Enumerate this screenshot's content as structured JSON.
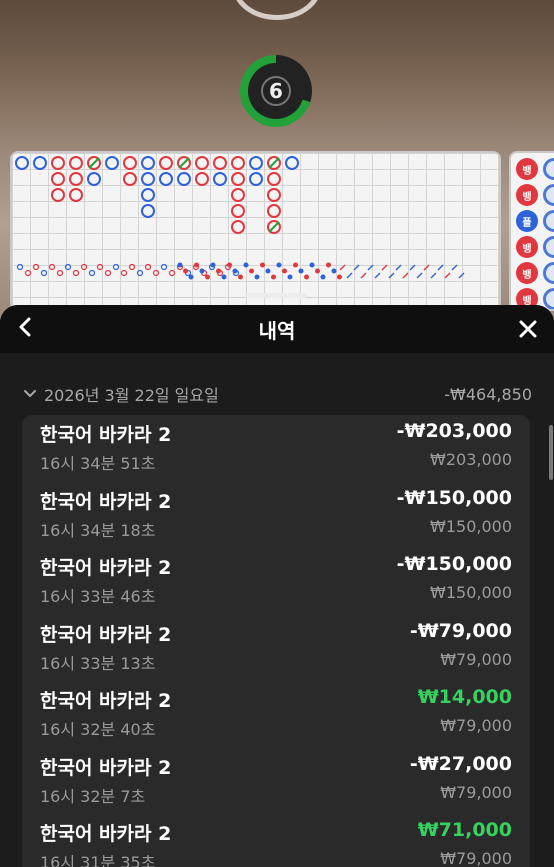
{
  "game": {
    "countdown": "6",
    "side_chips": [
      {
        "label": "뱅",
        "color": "#e0383e"
      },
      {
        "label": "뱅",
        "color": "#e0383e"
      },
      {
        "label": "플",
        "color": "#2d62d9"
      },
      {
        "label": "뱅",
        "color": "#e0383e"
      },
      {
        "label": "뱅",
        "color": "#e0383e"
      },
      {
        "label": "뱅",
        "color": "#e0383e"
      }
    ]
  },
  "sheet": {
    "title": "내역",
    "back_icon": "chevron-left-icon",
    "close_icon": "close-icon"
  },
  "date_group": {
    "date": "2026년 3월 22일 일요일",
    "total": "-₩464,850"
  },
  "transactions": [
    {
      "game": "한국어 바카라 2",
      "time": "16시 34분 51초",
      "result": "-₩203,000",
      "stake": "₩203,000",
      "positive": false
    },
    {
      "game": "한국어 바카라 2",
      "time": "16시 34분 18초",
      "result": "-₩150,000",
      "stake": "₩150,000",
      "positive": false
    },
    {
      "game": "한국어 바카라 2",
      "time": "16시 33분 46초",
      "result": "-₩150,000",
      "stake": "₩150,000",
      "positive": false
    },
    {
      "game": "한국어 바카라 2",
      "time": "16시 33분 13초",
      "result": "-₩79,000",
      "stake": "₩79,000",
      "positive": false
    },
    {
      "game": "한국어 바카라 2",
      "time": "16시 32분 40초",
      "result": "₩14,000",
      "stake": "₩79,000",
      "positive": true
    },
    {
      "game": "한국어 바카라 2",
      "time": "16시 32분 7초",
      "result": "-₩27,000",
      "stake": "₩79,000",
      "positive": false
    },
    {
      "game": "한국어 바카라 2",
      "time": "16시 31분 35초",
      "result": "₩71,000",
      "stake": "₩79,000",
      "positive": true
    }
  ],
  "colors": {
    "banker": "#e0383e",
    "player": "#2d62d9",
    "tie": "#21a137",
    "positive": "#35d35e",
    "timer_ring": "#21a137"
  }
}
